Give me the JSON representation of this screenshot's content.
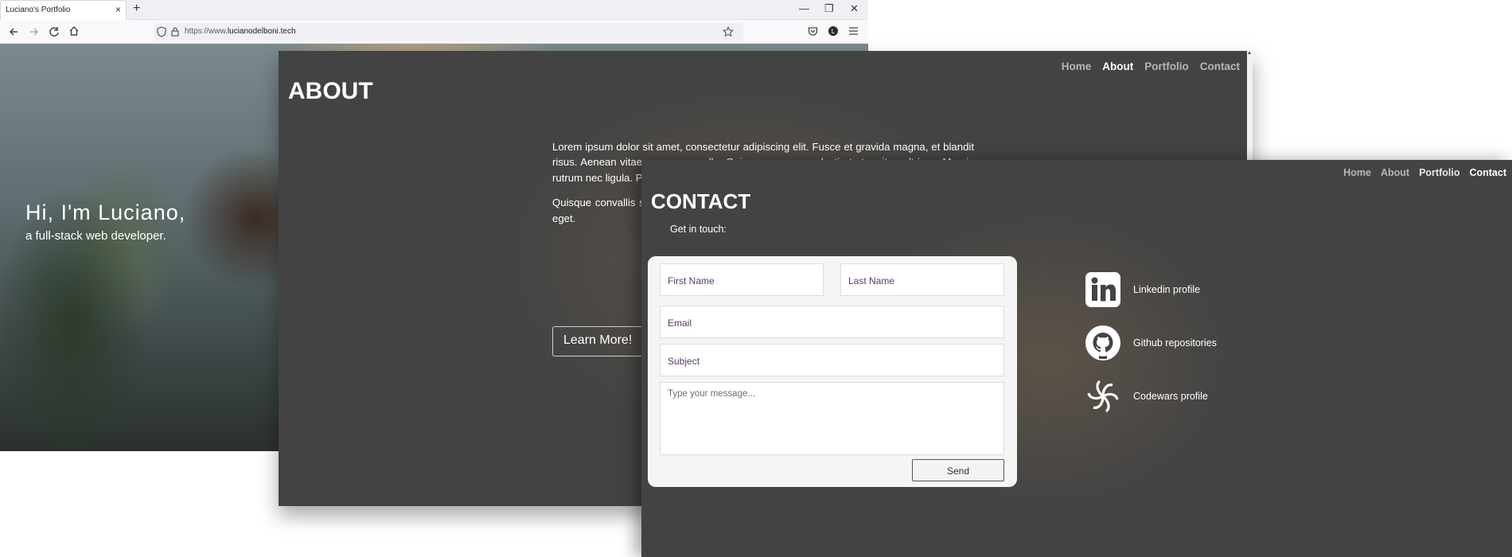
{
  "browser": {
    "tab_title": "Luciano's Portfolio",
    "tab_close": "×",
    "new_tab": "+",
    "url_prefix": "https://www.",
    "url_domain": "lucianodelboni.tech",
    "window_controls": [
      "—",
      "❐",
      "✕"
    ]
  },
  "hero": {
    "title": "Hi, I'm Luciano,",
    "subtitle": "a full-stack web developer."
  },
  "about": {
    "nav": [
      {
        "label": "Home",
        "active": false
      },
      {
        "label": "About",
        "active": true
      },
      {
        "label": "Portfolio",
        "active": false
      },
      {
        "label": "Contact",
        "active": false
      }
    ],
    "title": "ABOUT",
    "paragraphs": [
      "Lorem ipsum dolor sit amet, consectetur adipiscing elit. Fusce et gravida magna, et blandit risus. Aenean vitae accumsan nulla. Quisque congue molestie tortor vitae ultrices. Mauris rutrum nec ligula. Praesent lacinia tempor.",
      "Quisque convallis sapien quis magna gravida maximus elit diam, accumsan blandit urna, eget."
    ],
    "button": "Learn More!"
  },
  "contact": {
    "nav": [
      {
        "label": "Home",
        "active": false
      },
      {
        "label": "About",
        "active": false
      },
      {
        "label": "Portfolio",
        "active": false
      },
      {
        "label": "Contact",
        "active": true
      }
    ],
    "title": "CONTACT",
    "subtitle": "Get in touch:",
    "form": {
      "first_name": "First Name",
      "last_name": "Last Name",
      "email": "Email",
      "subject": "Subject",
      "message": "Type your message...",
      "send": "Send"
    },
    "links": [
      {
        "icon": "linkedin-icon",
        "label": "Linkedin profile"
      },
      {
        "icon": "github-icon",
        "label": "Github repositories"
      },
      {
        "icon": "codewars-icon",
        "label": "Codewars profile"
      }
    ]
  }
}
